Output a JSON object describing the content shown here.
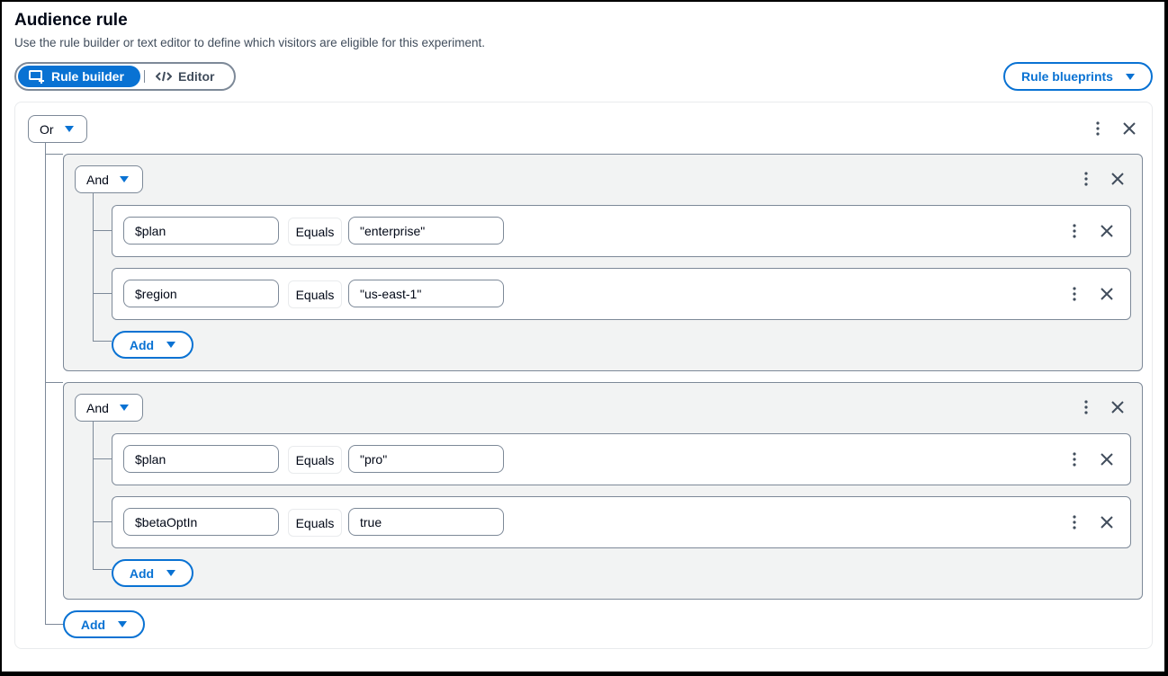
{
  "header": {
    "title": "Audience rule",
    "subtitle": "Use the rule builder or text editor to define which visitors are eligible for this experiment."
  },
  "mode_toggle": {
    "rule_builder_label": "Rule builder",
    "editor_label": "Editor",
    "selected": "Rule builder"
  },
  "blueprints_label": "Rule blueprints",
  "root": {
    "operator": "Or",
    "add_label": "Add",
    "groups": [
      {
        "operator": "And",
        "add_label": "Add",
        "conditions": [
          {
            "property": "$plan",
            "comparator": "Equals",
            "value": "\"enterprise\""
          },
          {
            "property": "$region",
            "comparator": "Equals",
            "value": "\"us-east-1\""
          }
        ]
      },
      {
        "operator": "And",
        "add_label": "Add",
        "conditions": [
          {
            "property": "$plan",
            "comparator": "Equals",
            "value": "\"pro\""
          },
          {
            "property": "$betaOptIn",
            "comparator": "Equals",
            "value": "true"
          }
        ]
      }
    ]
  },
  "icons": {
    "menu": "more-vertical-icon",
    "remove": "close-icon",
    "dropdown": "caret-down-icon"
  },
  "colors": {
    "accent": "#0972d3",
    "border": "#7d8998",
    "group_bg": "#f2f3f3",
    "text": "#000716"
  }
}
